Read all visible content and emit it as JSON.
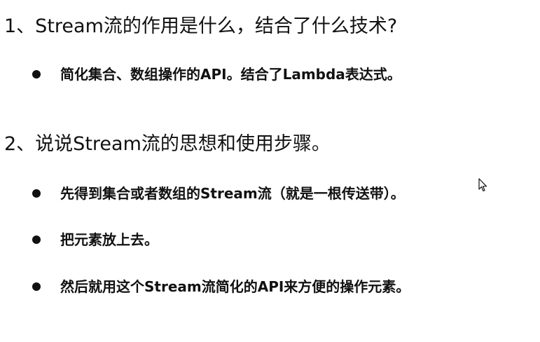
{
  "sections": [
    {
      "question": "1、Stream流的作用是什么，结合了什么技术?",
      "answers": [
        "简化集合、数组操作的API。结合了Lambda表达式。"
      ]
    },
    {
      "question": "2、说说Stream流的思想和使用步骤。",
      "answers": [
        "先得到集合或者数组的Stream流（就是一根传送带）。",
        "把元素放上去。",
        "然后就用这个Stream流简化的API来方便的操作元素。"
      ]
    }
  ],
  "icons": {
    "bullet": "bullet-dot-icon",
    "cursor": "mouse-pointer-icon"
  }
}
